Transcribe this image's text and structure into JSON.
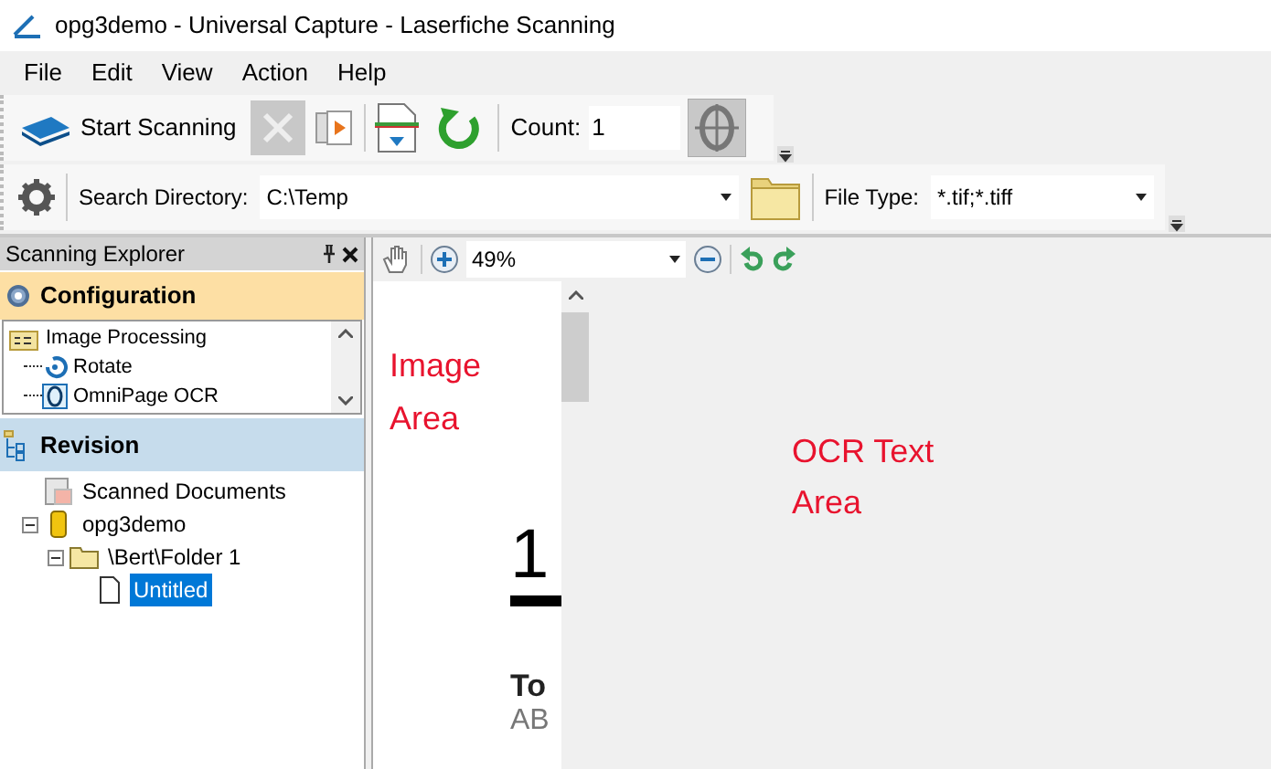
{
  "window": {
    "title": "opg3demo - Universal Capture - Laserfiche Scanning"
  },
  "menu": [
    "File",
    "Edit",
    "View",
    "Action",
    "Help"
  ],
  "toolbar": {
    "start_button": "Start Scanning",
    "count_label": "Count:",
    "count_value": "1"
  },
  "search_bar": {
    "directory_label": "Search Directory:",
    "directory_value": "C:\\Temp",
    "file_type_label": "File Type:",
    "file_type_value": "*.tif;*.tiff"
  },
  "explorer": {
    "title": "Scanning Explorer",
    "configuration": {
      "title": "Configuration",
      "items": [
        {
          "label": "Image Processing",
          "children": [
            {
              "label": "Rotate"
            },
            {
              "label": "OmniPage OCR"
            }
          ]
        }
      ]
    },
    "revision": {
      "title": "Revision",
      "items": [
        {
          "label": "Scanned Documents",
          "kind": "scanned",
          "selected": false
        },
        {
          "label": "opg3demo",
          "kind": "repository",
          "selected": false,
          "expanded": true,
          "children": [
            {
              "label": "\\Bert\\Folder 1",
              "kind": "folder",
              "selected": false,
              "expanded": true,
              "children": [
                {
                  "label": "Untitled",
                  "kind": "document",
                  "selected": true
                }
              ]
            }
          ]
        }
      ]
    }
  },
  "viewer": {
    "zoom": "49%",
    "image_note": [
      "Image",
      "Area"
    ],
    "document_lines": [
      "1",
      "To",
      "AB"
    ],
    "ocr_note": [
      "OCR Text",
      "Area"
    ]
  }
}
